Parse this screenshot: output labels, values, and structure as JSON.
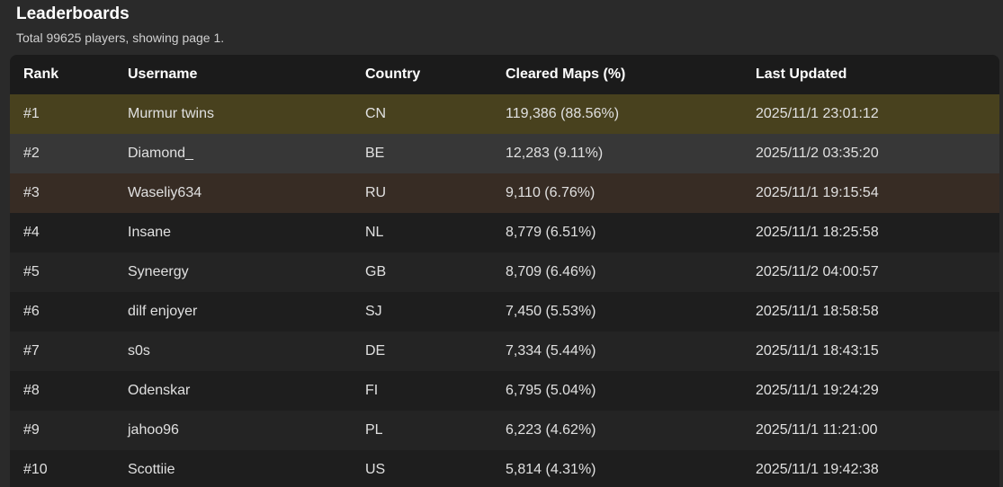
{
  "header": {
    "title": "Leaderboards",
    "subtitle": "Total 99625 players, showing page 1."
  },
  "table": {
    "columns": [
      "Rank",
      "Username",
      "Country",
      "Cleared Maps (%)",
      "Last Updated"
    ],
    "rows": [
      {
        "rank": "#1",
        "username": "Murmur twins",
        "country": "CN",
        "cleared": "119,386 (88.56%)",
        "updated": "2025/11/1 23:01:12"
      },
      {
        "rank": "#2",
        "username": "Diamond_",
        "country": "BE",
        "cleared": "12,283 (9.11%)",
        "updated": "2025/11/2 03:35:20"
      },
      {
        "rank": "#3",
        "username": "Waseliy634",
        "country": "RU",
        "cleared": "9,110 (6.76%)",
        "updated": "2025/11/1 19:15:54"
      },
      {
        "rank": "#4",
        "username": "Insane",
        "country": "NL",
        "cleared": "8,779 (6.51%)",
        "updated": "2025/11/1 18:25:58"
      },
      {
        "rank": "#5",
        "username": "Syneergy",
        "country": "GB",
        "cleared": "8,709 (6.46%)",
        "updated": "2025/11/2 04:00:57"
      },
      {
        "rank": "#6",
        "username": "dilf enjoyer",
        "country": "SJ",
        "cleared": "7,450 (5.53%)",
        "updated": "2025/11/1 18:58:58"
      },
      {
        "rank": "#7",
        "username": "s0s",
        "country": "DE",
        "cleared": "7,334 (5.44%)",
        "updated": "2025/11/1 18:43:15"
      },
      {
        "rank": "#8",
        "username": "Odenskar",
        "country": "FI",
        "cleared": "6,795 (5.04%)",
        "updated": "2025/11/1 19:24:29"
      },
      {
        "rank": "#9",
        "username": "jahoo96",
        "country": "PL",
        "cleared": "6,223 (4.62%)",
        "updated": "2025/11/1 11:21:00"
      },
      {
        "rank": "#10",
        "username": "Scottiie",
        "country": "US",
        "cleared": "5,814 (4.31%)",
        "updated": "2025/11/1 19:42:38"
      }
    ]
  },
  "colors": {
    "background": "#2a2a2a",
    "header_row": "#1b1b1b",
    "rank1": "#48411e",
    "rank2": "#373737",
    "rank3": "#372c24",
    "row_odd": "#242424",
    "row_even": "#1e1e1e"
  }
}
